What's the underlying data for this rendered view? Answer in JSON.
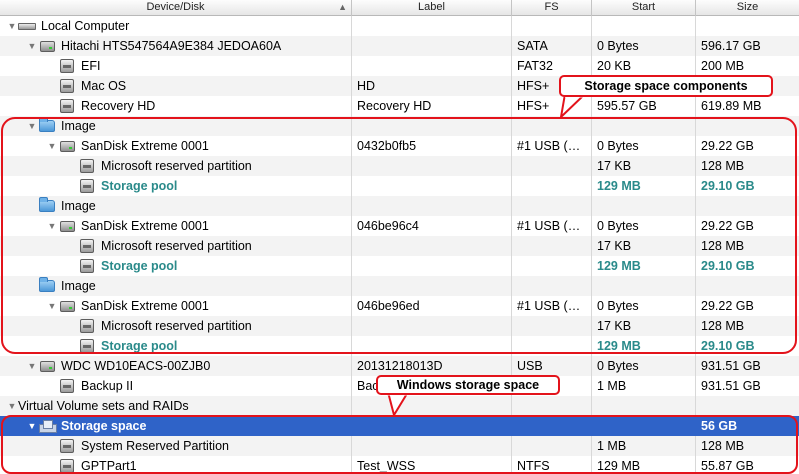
{
  "columns": {
    "device": "Device/Disk",
    "label": "Label",
    "fs": "FS",
    "start": "Start",
    "size": "Size",
    "sort_icon": "triangle-up-icon"
  },
  "rows": [
    {
      "level": 0,
      "expand": true,
      "icon": "computer",
      "name": "Local Computer",
      "label": "",
      "fs": "",
      "start": "",
      "size": ""
    },
    {
      "level": 1,
      "expand": true,
      "icon": "hdd",
      "name": "Hitachi HTS547564A9E384 JEDOA60A",
      "label": "",
      "fs": "SATA",
      "start": "0 Bytes",
      "size": "596.17 GB"
    },
    {
      "level": 2,
      "expand": false,
      "icon": "part",
      "name": "EFI",
      "label": "",
      "fs": "FAT32",
      "start": "20 KB",
      "size": "200 MB"
    },
    {
      "level": 2,
      "expand": false,
      "icon": "part",
      "name": "Mac OS",
      "label": "HD",
      "fs": "HFS+",
      "start": "",
      "size": ""
    },
    {
      "level": 2,
      "expand": false,
      "icon": "part",
      "name": "Recovery HD",
      "label": "Recovery HD",
      "fs": "HFS+",
      "start": "595.57 GB",
      "size": "619.89 MB"
    },
    {
      "level": 1,
      "expand": true,
      "icon": "folder",
      "name": "Image",
      "label": "",
      "fs": "",
      "start": "",
      "size": ""
    },
    {
      "level": 2,
      "expand": true,
      "icon": "hdd",
      "name": "SanDisk Extreme 0001",
      "label": "0432b0fb5",
      "fs": "#1 USB (…",
      "start": "0 Bytes",
      "size": "29.22 GB"
    },
    {
      "level": 3,
      "expand": false,
      "icon": "part",
      "name": "Microsoft reserved partition",
      "label": "",
      "fs": "",
      "start": "17 KB",
      "size": "128 MB"
    },
    {
      "level": 3,
      "expand": false,
      "icon": "part",
      "name": "Storage pool",
      "label": "",
      "fs": "",
      "start": "129 MB",
      "size": "29.10 GB",
      "pool": true
    },
    {
      "level": 1,
      "expand": false,
      "icon": "folder",
      "name": "Image",
      "label": "",
      "fs": "",
      "start": "",
      "size": ""
    },
    {
      "level": 2,
      "expand": true,
      "icon": "hdd",
      "name": "SanDisk Extreme 0001",
      "label": "046be96c4",
      "fs": "#1 USB (…",
      "start": "0 Bytes",
      "size": "29.22 GB"
    },
    {
      "level": 3,
      "expand": false,
      "icon": "part",
      "name": "Microsoft reserved partition",
      "label": "",
      "fs": "",
      "start": "17 KB",
      "size": "128 MB"
    },
    {
      "level": 3,
      "expand": false,
      "icon": "part",
      "name": "Storage pool",
      "label": "",
      "fs": "",
      "start": "129 MB",
      "size": "29.10 GB",
      "pool": true
    },
    {
      "level": 1,
      "expand": false,
      "icon": "folder",
      "name": "Image",
      "label": "",
      "fs": "",
      "start": "",
      "size": ""
    },
    {
      "level": 2,
      "expand": true,
      "icon": "hdd",
      "name": "SanDisk Extreme 0001",
      "label": "046be96ed",
      "fs": "#1 USB (…",
      "start": "0 Bytes",
      "size": "29.22 GB"
    },
    {
      "level": 3,
      "expand": false,
      "icon": "part",
      "name": "Microsoft reserved partition",
      "label": "",
      "fs": "",
      "start": "17 KB",
      "size": "128 MB"
    },
    {
      "level": 3,
      "expand": false,
      "icon": "part",
      "name": "Storage pool",
      "label": "",
      "fs": "",
      "start": "129 MB",
      "size": "29.10 GB",
      "pool": true
    },
    {
      "level": 1,
      "expand": true,
      "icon": "hdd",
      "name": "WDC WD10EACS-00ZJB0",
      "label": "20131218013D",
      "fs": "USB",
      "start": "0 Bytes",
      "size": "931.51 GB"
    },
    {
      "level": 2,
      "expand": false,
      "icon": "part",
      "name": "Backup II",
      "label": "Bac",
      "fs": "",
      "start": "1 MB",
      "size": "931.51 GB"
    },
    {
      "level": 0,
      "expand": true,
      "icon": "none",
      "name": "Virtual Volume sets and RAIDs",
      "label": "",
      "fs": "",
      "start": "",
      "size": ""
    },
    {
      "level": 1,
      "expand": true,
      "icon": "storage",
      "name": "Storage space",
      "label": "",
      "fs": "",
      "start": "",
      "size": "56 GB",
      "selected": true
    },
    {
      "level": 2,
      "expand": false,
      "icon": "part",
      "name": "System Reserved Partition",
      "label": "",
      "fs": "",
      "start": "1 MB",
      "size": "128 MB"
    },
    {
      "level": 2,
      "expand": false,
      "icon": "part",
      "name": "GPTPart1",
      "label": "Test_WSS",
      "fs": "NTFS",
      "start": "129 MB",
      "size": "55.87 GB"
    }
  ],
  "annotations": {
    "components": "Storage space components",
    "windows": "Windows storage space"
  },
  "colors": {
    "accent_red": "#e3131b",
    "selection": "#2f63c8",
    "pool_text": "#2a8a8a"
  }
}
